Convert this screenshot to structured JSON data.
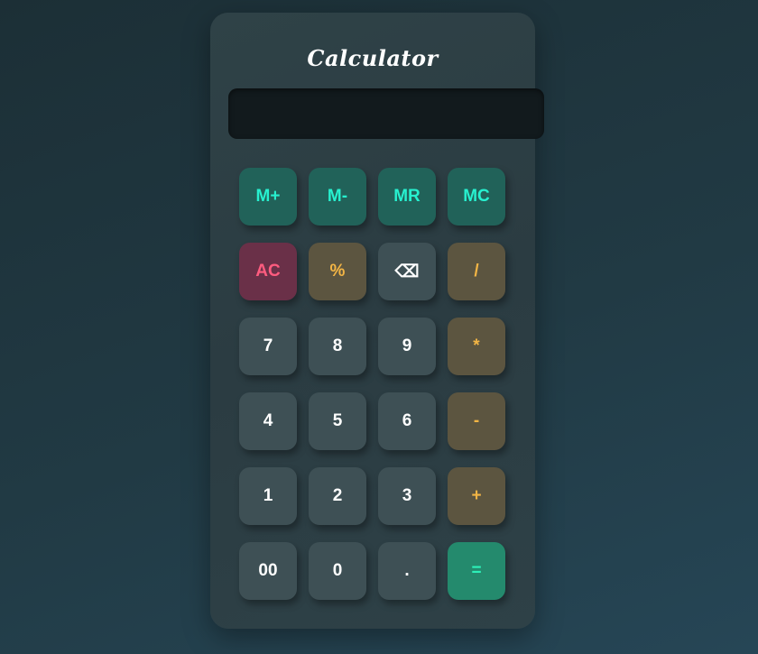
{
  "calculator": {
    "title": "Calculator",
    "display_value": ""
  },
  "keys": [
    {
      "label": "M+",
      "kind": "mem",
      "name": "memory-add-button"
    },
    {
      "label": "M-",
      "kind": "mem",
      "name": "memory-subtract-button"
    },
    {
      "label": "MR",
      "kind": "mem",
      "name": "memory-recall-button"
    },
    {
      "label": "MC",
      "kind": "mem",
      "name": "memory-clear-button"
    },
    {
      "label": "AC",
      "kind": "clear",
      "name": "all-clear-button"
    },
    {
      "label": "%",
      "kind": "op",
      "name": "percent-button"
    },
    {
      "label": "⌫",
      "kind": "num",
      "name": "backspace-button"
    },
    {
      "label": "/",
      "kind": "op",
      "name": "divide-button"
    },
    {
      "label": "7",
      "kind": "num",
      "name": "digit-7-button"
    },
    {
      "label": "8",
      "kind": "num",
      "name": "digit-8-button"
    },
    {
      "label": "9",
      "kind": "num",
      "name": "digit-9-button"
    },
    {
      "label": "*",
      "kind": "op",
      "name": "multiply-button"
    },
    {
      "label": "4",
      "kind": "num",
      "name": "digit-4-button"
    },
    {
      "label": "5",
      "kind": "num",
      "name": "digit-5-button"
    },
    {
      "label": "6",
      "kind": "num",
      "name": "digit-6-button"
    },
    {
      "label": "-",
      "kind": "op",
      "name": "subtract-button"
    },
    {
      "label": "1",
      "kind": "num",
      "name": "digit-1-button"
    },
    {
      "label": "2",
      "kind": "num",
      "name": "digit-2-button"
    },
    {
      "label": "3",
      "kind": "num",
      "name": "digit-3-button"
    },
    {
      "label": "+",
      "kind": "op",
      "name": "add-button"
    },
    {
      "label": "00",
      "kind": "num",
      "name": "double-zero-button"
    },
    {
      "label": "0",
      "kind": "num",
      "name": "digit-0-button"
    },
    {
      "label": ".",
      "kind": "num",
      "name": "decimal-button"
    },
    {
      "label": "=",
      "kind": "eq",
      "name": "equals-button"
    }
  ],
  "colors": {
    "memory_text": "#27f0cf",
    "clear_text": "#ff5c7f",
    "operator_text": "#f3b545",
    "equals_text": "#2df0b8"
  }
}
